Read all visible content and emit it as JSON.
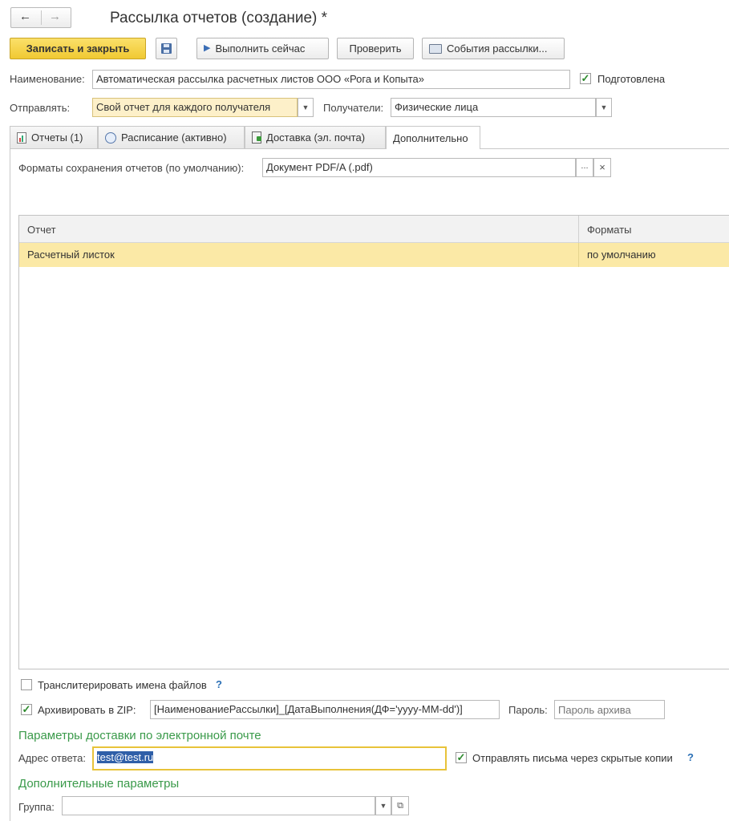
{
  "window": {
    "title": "Рассылка отчетов (создание) *",
    "nav_back": "←",
    "nav_forward": "→"
  },
  "toolbar": {
    "save_close": "Записать и закрыть",
    "run_now": "Выполнить сейчас",
    "check": "Проверить",
    "events": "События рассылки..."
  },
  "form": {
    "name_label": "Наименование:",
    "name_value": "Автоматическая рассылка расчетных листов ООО «Рога и Копыта»",
    "prepared_label": "Подготовлена",
    "prepared_checked": true,
    "send_label": "Отправлять:",
    "send_value": "Свой отчет для каждого получателя",
    "recipients_label": "Получатели:",
    "recipients_value": "Физические лица"
  },
  "tabs": [
    {
      "label": "Отчеты (1)"
    },
    {
      "label": "Расписание (активно)"
    },
    {
      "label": "Доставка (эл. почта)"
    },
    {
      "label": "Дополнительно"
    }
  ],
  "additional": {
    "formats_label": "Форматы сохранения отчетов (по умолчанию):",
    "formats_value": "Документ PDF/A (.pdf)",
    "select_btn": "...",
    "clear_btn": "×",
    "table": {
      "columns": [
        "Отчет",
        "Форматы"
      ],
      "rows": [
        {
          "report": "Расчетный листок",
          "formats": "по умолчанию"
        }
      ]
    },
    "transliterate_label": "Транслитерировать имена файлов",
    "transliterate_checked": false,
    "archive_label": "Архивировать в ZIP:",
    "archive_checked": true,
    "archive_template": "[НаименованиеРассылки]_[ДатаВыполнения(ДФ='yyyy-MM-dd')]",
    "password_label": "Пароль:",
    "password_placeholder": "Пароль архива",
    "help_mark": "?"
  },
  "email_section": {
    "title": "Параметры доставки по электронной почте",
    "reply_label": "Адрес ответа:",
    "reply_value": "test@test.ru",
    "bcc_label": "Отправлять письма через скрытые копии",
    "bcc_checked": true
  },
  "extra_section": {
    "title": "Дополнительные параметры",
    "group_label": "Группа:",
    "group_value": ""
  },
  "colors": {
    "accent_button": "#f5d23c",
    "selected_row": "#fbe9a6",
    "section_title": "#3a9a4a",
    "focus_border": "#e8c33a"
  }
}
